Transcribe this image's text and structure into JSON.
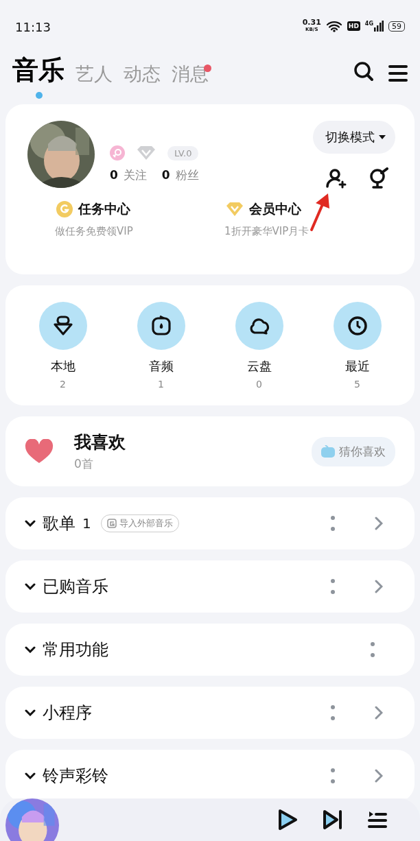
{
  "status_bar": {
    "time": "11:13",
    "net_speed": "0.31",
    "net_unit": "KB/S",
    "network": "4G",
    "hd": "HD",
    "battery": "59"
  },
  "tabs": [
    {
      "label": "音乐",
      "selected": true,
      "badge": false
    },
    {
      "label": "艺人",
      "selected": false,
      "badge": false
    },
    {
      "label": "动态",
      "selected": false,
      "badge": false
    },
    {
      "label": "消息",
      "selected": false,
      "badge": true
    }
  ],
  "profile": {
    "level": "LV.0",
    "following_count": "0",
    "following_label": "关注",
    "fans_count": "0",
    "fans_label": "粉丝",
    "mode_button": "切换模式",
    "centers": [
      {
        "kind": "task",
        "title": "任务中心",
        "subtitle": "做任务免费领VIP"
      },
      {
        "kind": "vip",
        "title": "会员中心",
        "subtitle": "1折开豪华VIP月卡"
      }
    ]
  },
  "shortcuts": [
    {
      "kind": "local",
      "label": "本地",
      "count": "2"
    },
    {
      "kind": "audio",
      "label": "音频",
      "count": "1"
    },
    {
      "kind": "cloud",
      "label": "云盘",
      "count": "0"
    },
    {
      "kind": "recent",
      "label": "最近",
      "count": "5"
    }
  ],
  "favorites": {
    "title": "我喜欢",
    "count": "0首",
    "button": "猜你喜欢"
  },
  "sections": [
    {
      "title": "歌单",
      "count": "1",
      "badge": "导入外部音乐",
      "arrow": true
    },
    {
      "title": "已购音乐",
      "arrow": true
    },
    {
      "title": "常用功能",
      "arrow": false
    },
    {
      "title": "小程序",
      "arrow": true
    },
    {
      "title": "铃声彩铃",
      "arrow": true
    }
  ]
}
